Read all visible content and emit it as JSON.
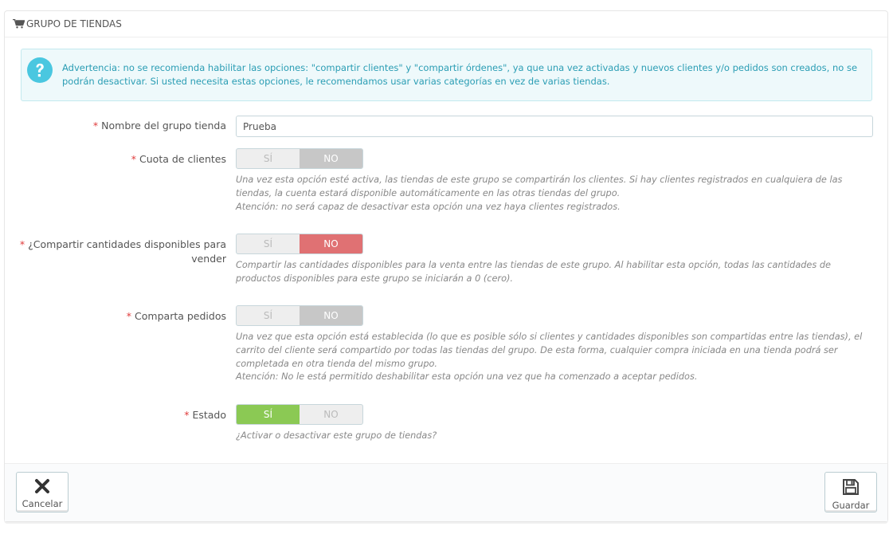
{
  "panel": {
    "title": "GRUPO DE TIENDAS"
  },
  "alert": {
    "text": "Advertencia: no se recomienda habilitar las opciones: \"compartir clientes\" y \"compartir órdenes\", ya que una vez activadas y nuevos clientes y/o pedidos son creados, no se podrán desactivar. Si usted necesita estas opciones, le recomendamos usar varias categorías en vez de varias tiendas."
  },
  "form": {
    "required_mark": "*",
    "name": {
      "label": "Nombre del grupo tienda",
      "value": "Prueba"
    },
    "share_customers": {
      "label": "Cuota de clientes",
      "yes": "SÍ",
      "no": "NO",
      "selected": "NO",
      "help1": "Una vez esta opción esté activa, las tiendas de este grupo se compartirán los clientes. Si hay clientes registrados en cualquiera de las tiendas, la cuenta estará disponible automáticamente en las otras tiendas del grupo.",
      "help2": "Atención: no será capaz de desactivar esta opción una vez haya clientes registrados."
    },
    "share_stock": {
      "label_line1": "¿Compartir cantidades disponibles para",
      "label_line2": "vender",
      "yes": "SÍ",
      "no": "NO",
      "selected": "NO",
      "help1": "Compartir las cantidades disponibles para la venta entre las tiendas de este grupo. Al habilitar esta opción, todas las cantidades de productos disponibles para este grupo se iniciarán a 0 (cero)."
    },
    "share_orders": {
      "label": "Comparta pedidos",
      "yes": "SÍ",
      "no": "NO",
      "selected": "NO",
      "help1": "Una vez que esta opción está establecida (lo que es posible sólo si clientes y cantidades disponibles son compartidas entre las tiendas), el carrito del cliente será compartido por todas las tiendas del grupo. De esta forma, cualquier compra iniciada en una tienda podrá ser completada en otra tienda del mismo grupo.",
      "help2": "Atención: No le está permitido deshabilitar esta opción una vez que ha comenzado a aceptar pedidos."
    },
    "status": {
      "label": "Estado",
      "yes": "SÍ",
      "no": "NO",
      "selected": "SÍ",
      "help1": "¿Activar o desactivar este grupo de tiendas?"
    }
  },
  "footer": {
    "cancel_label": "Cancelar",
    "save_label": "Guardar"
  },
  "colors": {
    "info": "#2a9db4",
    "required": "#e03c3c",
    "no_active": "#e07173",
    "yes_active": "#8bc954"
  }
}
